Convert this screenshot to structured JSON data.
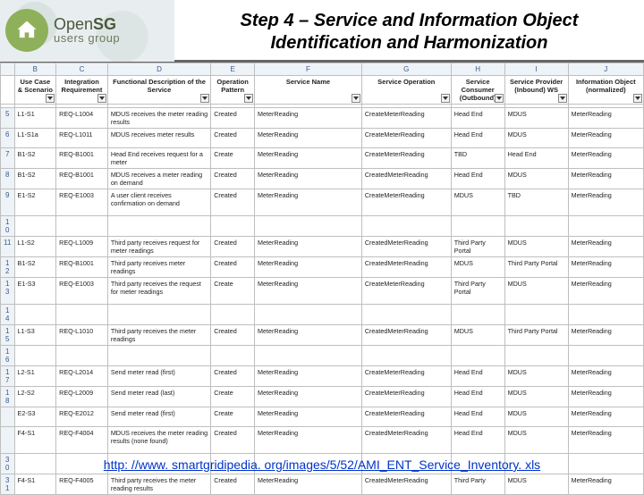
{
  "brand": {
    "line1a": "Open",
    "line1b": "SG",
    "line2": "users group"
  },
  "title": "Step 4 – Service and Information Object Identification and Harmonization",
  "columns_letters": [
    "",
    "B",
    "C",
    "D",
    "E",
    "F",
    "G",
    "H",
    "I",
    "J"
  ],
  "headers": [
    "Use Case & Scenario",
    "Integration Requirement",
    "Functional Description of the Service",
    "Operation Pattern",
    "Service Name",
    "Service Operation",
    "Service Consumer (Outbound)",
    "Service Provider (Inbound) WS",
    "Information Object (normalized)"
  ],
  "rows": [
    {
      "n": "5",
      "c": [
        "L1-S1",
        "REQ-L1004",
        "MDUS receives the meter reading results",
        "Created",
        "MeterReading",
        "CreateMeterReading",
        "Head End",
        "MDUS",
        "MeterReading"
      ]
    },
    {
      "n": "6",
      "c": [
        "L1-S1a",
        "REQ-L1011",
        "MDUS receives meter results",
        "Created",
        "MeterReading",
        "CreateMeterReading",
        "Head End",
        "MDUS",
        "MeterReading"
      ]
    },
    {
      "n": "7",
      "c": [
        "B1-S2",
        "REQ-B1001",
        "Head End receives request for a meter",
        "Create",
        "MeterReading",
        "CreateMeterReading",
        "TBD",
        "Head End",
        "MeterReading"
      ]
    },
    {
      "n": "8",
      "c": [
        "B1-S2",
        "REQ-B1001",
        "MDUS receives a meter reading on demand",
        "Created",
        "MeterReading",
        "CreatedMeterReading",
        "Head End",
        "MDUS",
        "MeterReading"
      ]
    },
    {
      "n": "9",
      "c": [
        "E1-S2",
        "REQ-E1003",
        "A user client receives confirmation on demand",
        "Created",
        "MeterReading",
        "CreateMeterReading",
        "MDUS",
        "TBD",
        "MeterReading"
      ],
      "tall": true
    },
    {
      "n": "10",
      "c": [
        "",
        "",
        "",
        "",
        "",
        "",
        "",
        "",
        ""
      ]
    },
    {
      "n": "11",
      "c": [
        "L1-S2",
        "REQ-L1009",
        "Third party receives request for meter readings",
        "Created",
        "MeterReading",
        "CreatedMeterReading",
        "Third Party Portal",
        "MDUS",
        "MeterReading"
      ]
    },
    {
      "n": "12",
      "c": [
        "B1-S2",
        "REQ-B1001",
        "Third party receives meter readings",
        "Created",
        "MeterReading",
        "CreatedMeterReading",
        "MDUS",
        "Third Party Portal",
        "MeterReading"
      ]
    },
    {
      "n": "13",
      "c": [
        "E1-S3",
        "REQ-E1003",
        "Third party receives the request for meter readings",
        "Create",
        "MeterReading",
        "CreateMeterReading",
        "Third Party Portal",
        "MDUS",
        "MeterReading"
      ],
      "tall": true
    },
    {
      "n": "14",
      "c": [
        "",
        "",
        "",
        "",
        "",
        "",
        "",
        "",
        ""
      ]
    },
    {
      "n": "15",
      "c": [
        "L1-S3",
        "REQ-L1010",
        "Third party receives the meter readings",
        "Created",
        "MeterReading",
        "CreatedMeterReading",
        "MDUS",
        "Third Party Portal",
        "MeterReading"
      ]
    },
    {
      "n": "16",
      "c": [
        "",
        "",
        "",
        "",
        "",
        "",
        "",
        "",
        ""
      ]
    },
    {
      "n": "17",
      "c": [
        "L2-S1",
        "REQ-L2014",
        "Send meter read (first)",
        "Created",
        "MeterReading",
        "CreateMeterReading",
        "Head End",
        "MDUS",
        "MeterReading"
      ]
    },
    {
      "n": "18",
      "c": [
        "L2-S2",
        "REQ-L2009",
        "Send meter read (last)",
        "Create",
        "MeterReading",
        "CreateMeterReading",
        "Head End",
        "MDUS",
        "MeterReading"
      ]
    },
    {
      "n": "",
      "c": [
        "E2-S3",
        "REQ-E2012",
        "Send meter read (first)",
        "Create",
        "MeterReading",
        "CreateMeterReading",
        "Head End",
        "MDUS",
        "MeterReading"
      ]
    },
    {
      "n": "",
      "c": [
        "F4-S1",
        "REQ-F4004",
        "MDUS receives the meter reading results (none found)",
        "Created",
        "MeterReading",
        "CreatedMeterReading",
        "Head End",
        "MDUS",
        "MeterReading"
      ],
      "tall": true
    },
    {
      "n": "30",
      "c": [
        "",
        "",
        "",
        "",
        "",
        "",
        "",
        "",
        ""
      ]
    },
    {
      "n": "31",
      "c": [
        "F4-S1",
        "REQ-F4005",
        "Third party receives the meter reading results",
        "Created",
        "MeterReading",
        "CreatedMeterReading",
        "Third Party",
        "MDUS",
        "MeterReading"
      ]
    }
  ],
  "footer_url": "http: //www. smartgridipedia. org/images/5/52/AMI_ENT_Service_Inventory. xls"
}
